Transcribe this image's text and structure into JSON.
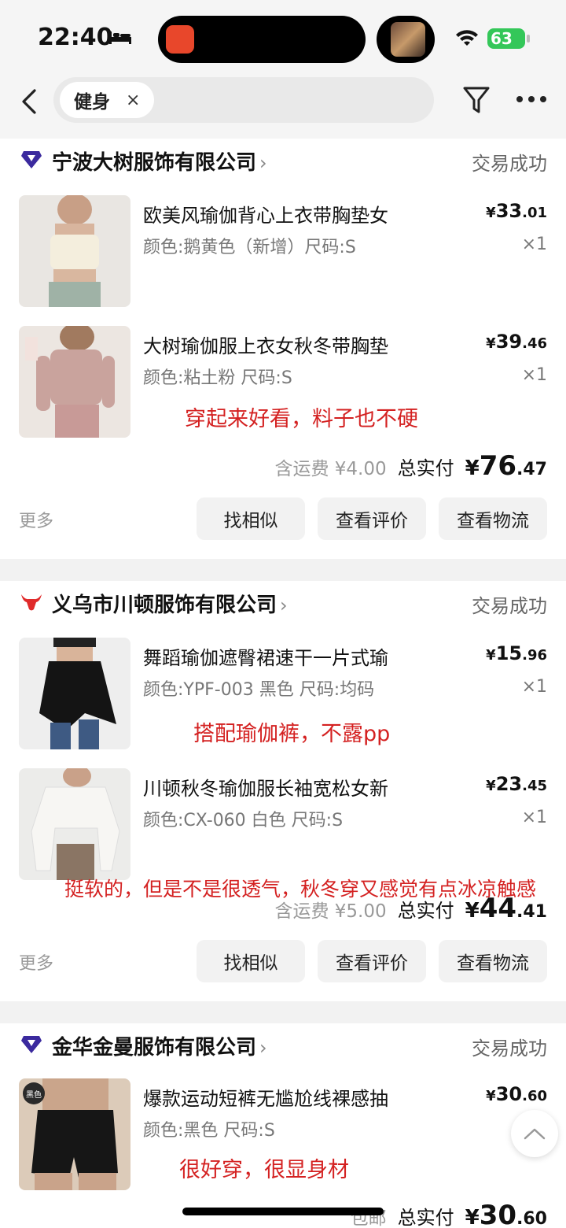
{
  "status_bar": {
    "time": "22:40",
    "battery": "63"
  },
  "search": {
    "keyword": "健身",
    "close_glyph": "×"
  },
  "icons": [
    "back-icon",
    "filter-icon",
    "more-icon",
    "bed-icon",
    "wifi-icon"
  ],
  "common": {
    "more": "更多",
    "btn_similar": "找相似",
    "btn_review": "查看评价",
    "btn_logistics": "查看物流",
    "total_label": "总实付",
    "status": "交易成功",
    "chevron": "›",
    "yen": "¥",
    "qty": "×1"
  },
  "orders": [
    {
      "shop": "宁波大树服饰有限公司",
      "shop_icon": "diamond-icon",
      "items": [
        {
          "title": "欧美风瑜伽背心上衣带胸垫女",
          "spec": "颜色:鹅黄色（新增）尺码:S",
          "price_int": "33",
          "price_dec": ".01",
          "qty": "×1"
        },
        {
          "title": "大树瑜伽服上衣女秋冬带胸垫",
          "spec": "颜色:粘土粉 尺码:S",
          "price_int": "39",
          "price_dec": ".46",
          "qty": "×1",
          "annotation": "穿起来好看，料子也不硬"
        }
      ],
      "shipping": "含运费 ¥4.00",
      "total_int": "76",
      "total_dec": ".47"
    },
    {
      "shop": "义乌市川顿服饰有限公司",
      "shop_icon": "bull-icon",
      "items": [
        {
          "title": "舞蹈瑜伽遮臀裙速干一片式瑜",
          "spec": "颜色:YPF-003 黑色 尺码:均码",
          "price_int": "15",
          "price_dec": ".96",
          "qty": "×1",
          "annotation": "搭配瑜伽裤，不露pp"
        },
        {
          "title": "川顿秋冬瑜伽服长袖宽松女新",
          "spec": "颜色:CX-060 白色 尺码:S",
          "price_int": "23",
          "price_dec": ".45",
          "qty": "×1",
          "annotation": "挺软的，但是不是很透气，秋冬穿又感觉有点冰凉触感"
        }
      ],
      "shipping": "含运费 ¥5.00",
      "total_int": "44",
      "total_dec": ".41"
    },
    {
      "shop": "金华金曼服饰有限公司",
      "shop_icon": "diamond-icon",
      "items": [
        {
          "title": "爆款运动短裤无尴尬线裸感抽",
          "spec": "颜色:黑色 尺码:S",
          "price_int": "30",
          "price_dec": ".60",
          "qty": "",
          "annotation": "很好穿，很显身材",
          "thumb_badge": "黑色"
        }
      ],
      "shipping": "包邮",
      "total_int": "30",
      "total_dec": ".60"
    }
  ],
  "colors": {
    "annotation": "#d42121",
    "diamond": "#3b2a9e",
    "bull": "#e02a2a",
    "battery": "#34c759"
  }
}
